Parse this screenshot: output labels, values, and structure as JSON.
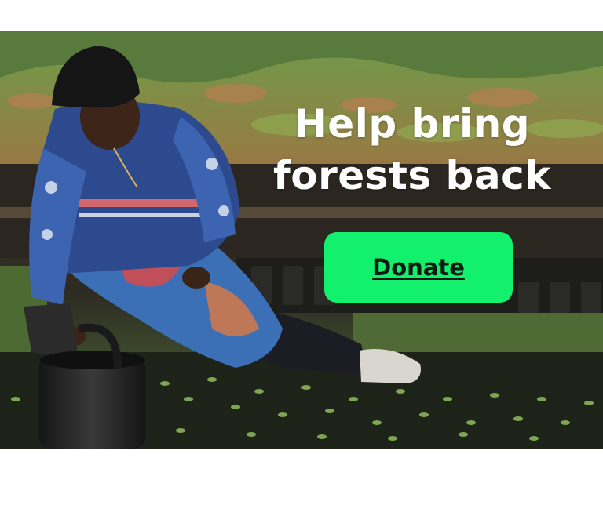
{
  "banner": {
    "headline": "Help bring forests back",
    "donate_label": "Donate",
    "button_color": "#12f06e",
    "headline_color": "#ffffff"
  }
}
